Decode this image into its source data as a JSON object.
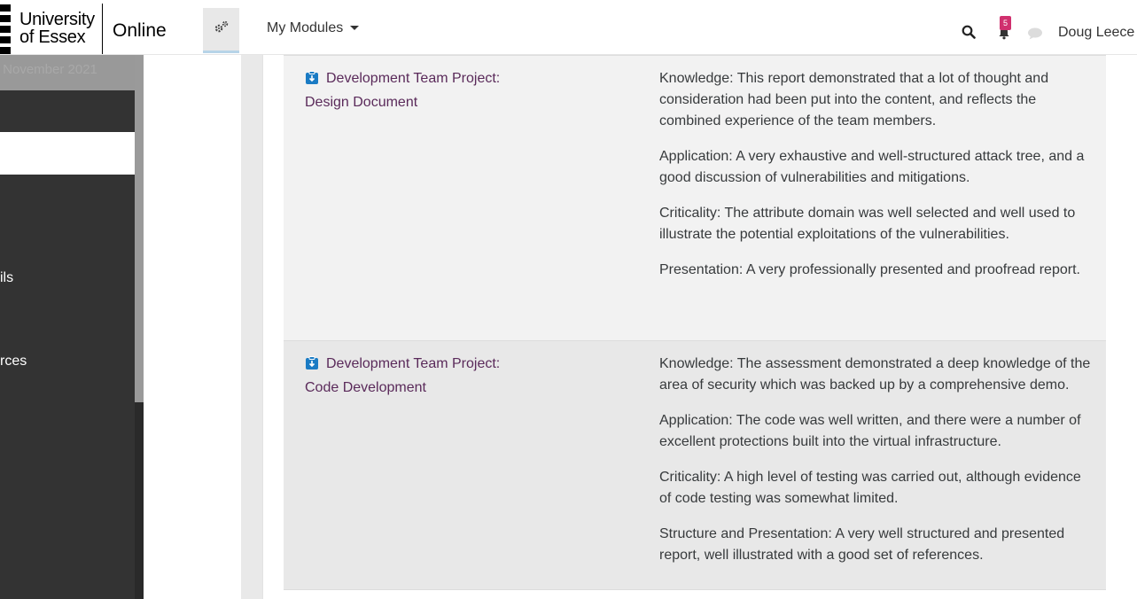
{
  "header": {
    "logo_line1": "University",
    "logo_line2": "of Essex",
    "logo_online": "Online",
    "my_modules_label": "My Modules",
    "notification_count": "5",
    "user_name": "Doug Leece"
  },
  "drawer": {
    "top_text": "- November 2021",
    "items": [
      {
        "label": "ils"
      },
      {
        "label": "rces"
      }
    ]
  },
  "rows": [
    {
      "assignment_line1": "Development Team Project:",
      "assignment_line2": "Design Document",
      "feedback": [
        "Knowledge: This report demonstrated that a lot of thought and consideration had been put into the content, and reflects the combined experience of the team members.",
        "Application: A very exhaustive and well-structured attack tree, and a good discussion of vulnerabilities and mitigations.",
        "Criticality: The attribute domain was well selected and well used to illustrate the potential exploitations of the vulnerabilities.",
        "Presentation: A very professionally presented and proofread report."
      ]
    },
    {
      "assignment_line1": "Development Team Project:",
      "assignment_line2": "Code Development",
      "feedback": [
        "Knowledge: The assessment demonstrated a deep knowledge of the area of security which was backed up by a comprehensive demo.",
        "Application: The code was well written, and there were a number of excellent protections built into the virtual infrastructure.",
        "Criticality: A high level of testing was carried out, although evidence of code testing was somewhat limited.",
        "Structure and Presentation: A very well structured and presented report, well illustrated with a good set of references."
      ]
    }
  ],
  "colors": {
    "link": "#5a2a5a",
    "badge": "#d0306e",
    "assign_icon": "#1a7bc4",
    "drawer": "#333333"
  },
  "icons": [
    "gears-icon",
    "search-icon",
    "bell-icon",
    "chat-icon",
    "assignment-icon"
  ]
}
